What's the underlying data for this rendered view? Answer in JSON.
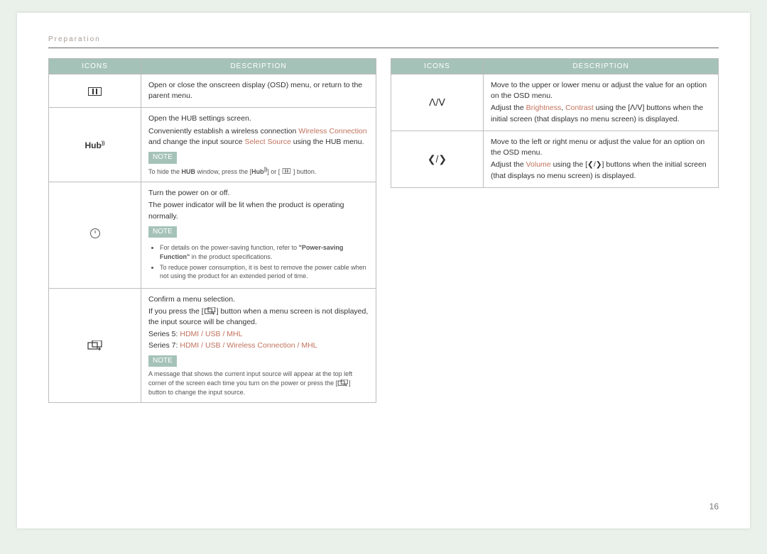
{
  "section_title": "Preparation",
  "page_number": "16",
  "headers": {
    "icons": "ICONS",
    "desc": "DESCRIPTION"
  },
  "note_label": "NOTE",
  "left": [
    {
      "id": "menu",
      "desc_main": "Open or close the onscreen display (OSD) menu, or return to the parent menu."
    },
    {
      "id": "hub",
      "line1": "Open the HUB settings screen.",
      "line2_a": "Conveniently establish a wireless connection ",
      "link1": "Wireless Connection",
      "line2_b": " and change the input source ",
      "link2": "Select Source",
      "line2_c": " using the HUB menu.",
      "note": "To hide the ",
      "note_b": "HUB",
      "note_c": " window, press the [",
      "note_d": "] or [",
      "note_e": "] button."
    },
    {
      "id": "power",
      "line1": "Turn the power on or off.",
      "line2": "The power indicator will be lit when the product is operating normally.",
      "bullet1_a": "For details on the power-saving function, refer to ",
      "bullet1_b": "\"Power-saving Function\"",
      "bullet1_c": " in the product specifications.",
      "bullet2": "To reduce power consumption, it is best to remove the power cable when not using the product for an extended period of time."
    },
    {
      "id": "source",
      "line1": "Confirm a menu selection.",
      "line2_a": "If you press the [",
      "line2_b": "] button when a menu screen is not displayed, the input source will be changed.",
      "series5_label": "Series 5: ",
      "series5_v": "HDMI / USB / MHL",
      "series7_label": "Series 7: ",
      "series7_v": "HDMI / USB / Wireless Connection / MHL",
      "note_a": "A message that shows the current input source will appear at the top left corner of the screen each time you turn on the power or press the [",
      "note_b": "] button to change the input source."
    }
  ],
  "right": [
    {
      "id": "updown",
      "icon": "ᐱ/ᐯ",
      "line1": "Move to the upper or lower menu or adjust the value for an option on the OSD menu.",
      "line2_a": "Adjust the ",
      "link1": "Brightness",
      "sep": ", ",
      "link2": "Contrast",
      "line2_b": " using the [",
      "line2_c": "] buttons when the initial screen (that displays no menu screen) is displayed.",
      "icons_inline": "ᐱ/ᐯ"
    },
    {
      "id": "leftright",
      "icon": "❮/❯",
      "line1": "Move to the left or right menu or adjust the value for an option on the OSD menu.",
      "line2_a": "Adjust the ",
      "link1": "Volume",
      "line2_b": " using the [",
      "line2_c": "] buttons when the initial screen (that displays no menu screen) is displayed.",
      "icons_inline": "❮/❯"
    }
  ]
}
